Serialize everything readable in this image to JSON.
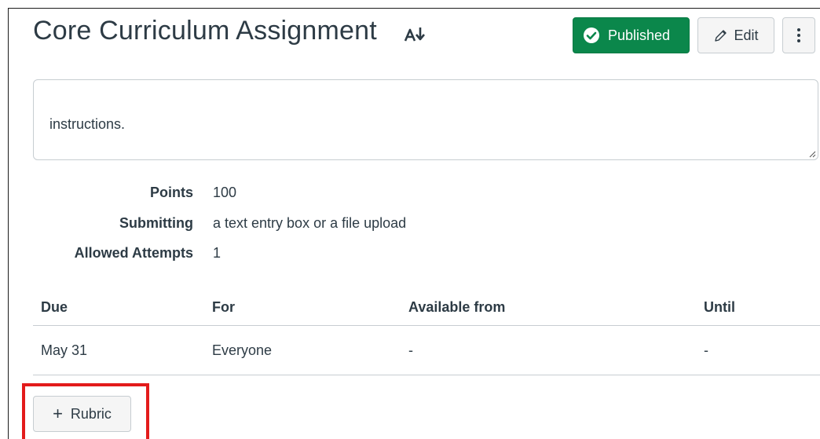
{
  "header": {
    "title": "Core Curriculum Assignment",
    "title_icon": "ai-sparkle-icon",
    "published_label": "Published",
    "published_icon": "check-circle-icon",
    "edit_label": "Edit",
    "edit_icon": "pencil-icon",
    "more_icon": "kebab-menu-icon"
  },
  "description": {
    "text": "instructions."
  },
  "details": [
    {
      "label": "Points",
      "value": "100"
    },
    {
      "label": "Submitting",
      "value": "a text entry box or a file upload"
    },
    {
      "label": "Allowed Attempts",
      "value": "1"
    }
  ],
  "dates_table": {
    "headers": [
      "Due",
      "For",
      "Available from",
      "Until"
    ],
    "rows": [
      [
        "May 31",
        "Everyone",
        "-",
        "-"
      ]
    ]
  },
  "rubric": {
    "icon": "plus-icon",
    "label": "Rubric"
  },
  "colors": {
    "published_green": "#0b874b",
    "highlight_red": "#e31b1b",
    "text": "#2d3b45",
    "border": "#c7cdd1"
  }
}
